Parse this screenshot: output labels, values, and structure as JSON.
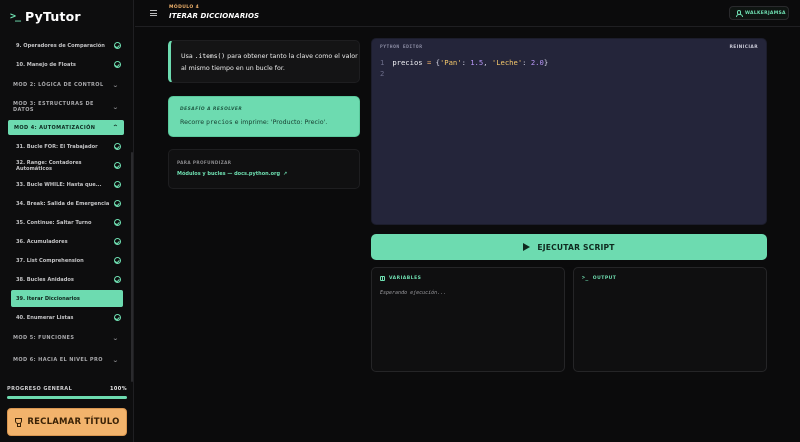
{
  "app": {
    "name": "PyTutor",
    "logo_glyph": ">_"
  },
  "header": {
    "module_label": "MÓDULO 4",
    "lesson_title": "ITERAR DICCIONARIOS",
    "user": "WALKERJAMSA"
  },
  "sidebar": {
    "items": [
      {
        "label": "9. Operadores de Comparación",
        "type": "lesson",
        "done": true
      },
      {
        "label": "10. Manejo de Floats",
        "type": "lesson",
        "done": true
      },
      {
        "label": "MOD 2: LÓGICA DE CONTROL",
        "type": "module"
      },
      {
        "label": "MOD 3: ESTRUCTURAS DE DATOS",
        "type": "module"
      },
      {
        "label": "MOD 4: AUTOMATIZACIÓN",
        "type": "module",
        "open": true
      },
      {
        "label": "31. Bucle FOR: El Trabajador",
        "type": "lesson",
        "done": true
      },
      {
        "label": "32. Range: Contadores Automáticos",
        "type": "lesson",
        "done": true
      },
      {
        "label": "33. Bucle WHILE: Hasta que...",
        "type": "lesson",
        "done": true
      },
      {
        "label": "34. Break: Salida de Emergencia",
        "type": "lesson",
        "done": true
      },
      {
        "label": "35. Continue: Saltar Turno",
        "type": "lesson",
        "done": true
      },
      {
        "label": "36. Acumuladores",
        "type": "lesson",
        "done": true
      },
      {
        "label": "37. List Comprehension",
        "type": "lesson",
        "done": true
      },
      {
        "label": "38. Bucles Anidados",
        "type": "lesson",
        "done": true
      },
      {
        "label": "39. Iterar Diccionarios",
        "type": "lesson",
        "active": true
      },
      {
        "label": "40. Enumerar Listas",
        "type": "lesson",
        "done": true
      },
      {
        "label": "MOD 5: FUNCIONES",
        "type": "module"
      },
      {
        "label": "MOD 6: HACIA EL NIVEL PRO",
        "type": "module"
      }
    ],
    "progress_label": "PROGRESO GENERAL",
    "progress_value": "100%",
    "progress_fraction": 1.0,
    "claim_button": "RECLAMAR TÍTULO"
  },
  "explain": {
    "before": "Usa ",
    "code": ".items()",
    "after": " para obtener tanto la clave como el valor al mismo tiempo en un bucle for."
  },
  "challenge": {
    "label": "DESAFÍO A RESOLVER",
    "before": "Recorre ",
    "code": "precios",
    "after": " e imprime: 'Producto: Precio'."
  },
  "deeper": {
    "label": "PARA PROFUNDIZAR",
    "link": "Módulos y bucles — docs.python.org"
  },
  "editor": {
    "label": "PYTHON EDITOR",
    "reset": "REINICIAR",
    "lines": [
      "1",
      "2"
    ],
    "code": {
      "var": "precios",
      "op": "=",
      "open": "{",
      "k1": "'Pan'",
      "colon1": ":",
      "v1": "1.5",
      "comma": ",",
      "k2": "'Leche'",
      "colon2": ":",
      "v2": "2.0",
      "close": "}"
    }
  },
  "run_button": "EJECUTAR SCRIPT",
  "variables": {
    "label": "VARIABLES",
    "placeholder": "Esperando ejecución..."
  },
  "output": {
    "label": "OUTPUT"
  },
  "colors": {
    "accent": "#6ddbb0",
    "warm": "#f2b36c",
    "editor_bg": "#24253a"
  }
}
